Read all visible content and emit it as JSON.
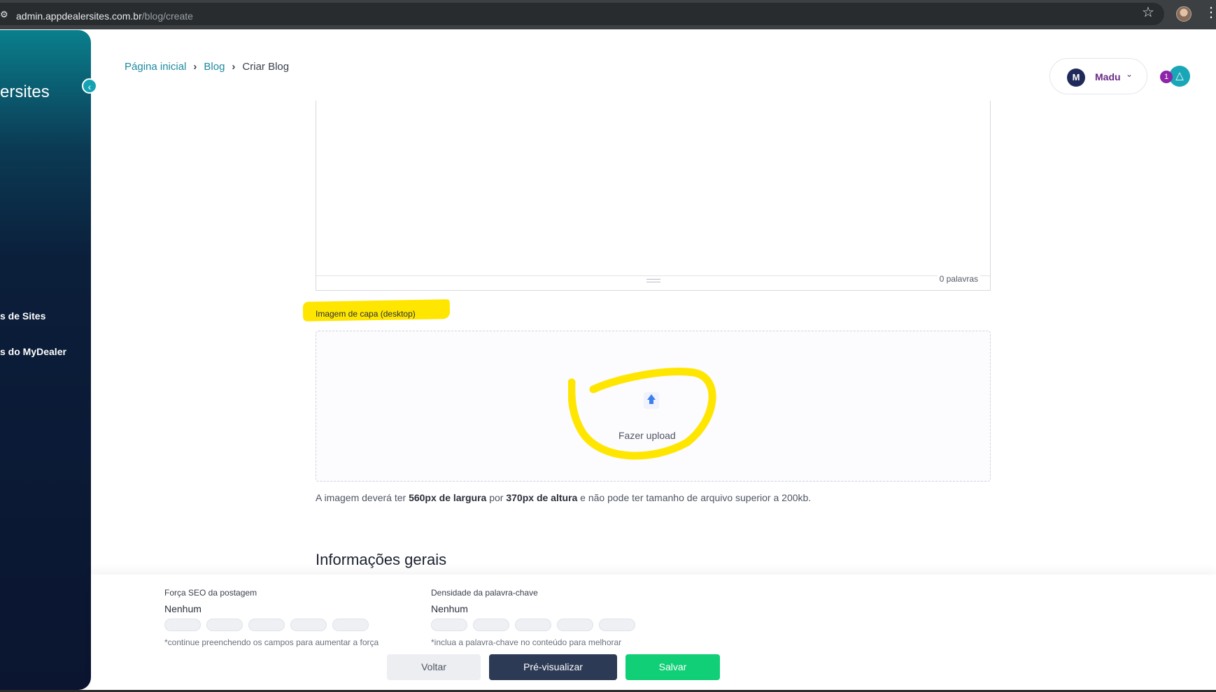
{
  "browser": {
    "url_domain": "admin.appdealersites.com.br",
    "url_path": "/blog/create"
  },
  "sidebar": {
    "brand_partial": "ersites",
    "items": [
      {
        "label": "s de Sites"
      },
      {
        "label": "s do MyDealer"
      }
    ]
  },
  "breadcrumb": {
    "items": [
      "Página inicial",
      "Blog",
      "Criar Blog"
    ]
  },
  "user": {
    "initial": "M",
    "name": "Madu",
    "notifications_count": "1"
  },
  "editor": {
    "word_count": "0 palavras"
  },
  "cover_image": {
    "label": "Imagem de capa (desktop)",
    "upload_text": "Fazer upload",
    "hint_prefix": "A imagem deverá ter ",
    "hint_width": "560px de largura",
    "hint_middle": " por ",
    "hint_height": "370px de altura",
    "hint_suffix": " e não pode ter tamanho de arquivo superior a 200kb."
  },
  "section": {
    "title": "Informações gerais"
  },
  "footer": {
    "seo_strength": {
      "title": "Força SEO da postagem",
      "value": "Nenhum",
      "levels": 5,
      "note": "*continue preenchendo os campos para aumentar a força"
    },
    "keyword_density": {
      "title": "Densidade da palavra-chave",
      "value": "Nenhum",
      "levels": 5,
      "note": "*inclua a palavra-chave no conteúdo para melhorar"
    },
    "back_label": "Voltar",
    "preview_label": "Pré-visualizar",
    "save_label": "Salvar"
  },
  "colors": {
    "accent_teal": "#19a7b8",
    "save_green": "#10cf76",
    "preview_navy": "#2c3a55",
    "highlight_yellow": "#ffe600"
  }
}
